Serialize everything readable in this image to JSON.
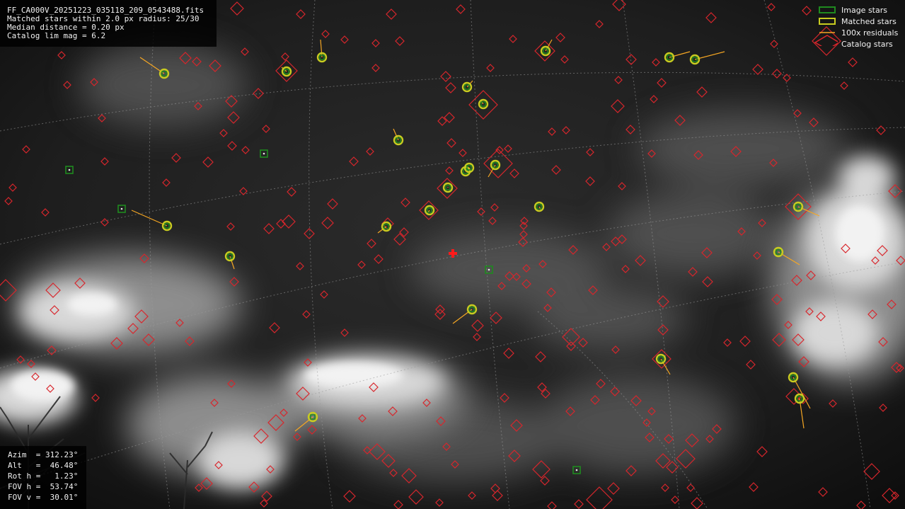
{
  "info": {
    "filename": "FF_CA000V_20251223_035118_209_0543488.fits",
    "matched": "Matched stars within 2.0 px radius: 25/30",
    "median": "Median distance = 0.20 px",
    "limmag": "Catalog lim mag = 6.2"
  },
  "pointing": {
    "azim": "Azim  = 312.23°",
    "alt": "Alt   =  46.48°",
    "roth": "Rot h =   1.23°",
    "fovh": "FOV h =  53.74°",
    "fovv": "FOV v =  30.01°"
  },
  "legend": {
    "image_stars": "Image stars",
    "matched_stars": "Matched stars",
    "residuals": "100x residuals",
    "catalog_stars": "Catalog stars"
  },
  "colors": {
    "image_star": "#1f8a1f",
    "matched_star": "#c8cc20",
    "residual": "#f5a623",
    "catalog_star": "#d8262c",
    "center_mark": "#ff1a1a",
    "grid": "#9a9a9a"
  },
  "icons": {
    "image_star": "green-square-icon",
    "matched_star": "yellow-circle-icon",
    "residual": "orange-line-icon",
    "catalog_star": "red-diamond-icon",
    "center": "red-cross-icon"
  }
}
